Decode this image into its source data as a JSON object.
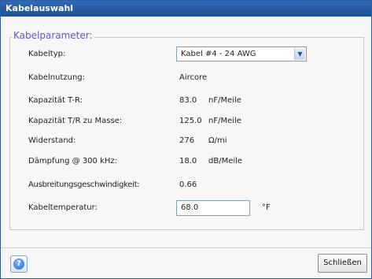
{
  "window": {
    "title": "Kabelauswahl"
  },
  "group": {
    "legend": "Kabelparameter:"
  },
  "fields": {
    "kabeltyp": {
      "label": "Kabeltyp:",
      "selected": "Kabel #4 - 24 AWG"
    },
    "kabelnutzung": {
      "label": "Kabelnutzung:",
      "value": "Aircore"
    },
    "kapazitaet_tr": {
      "label": "Kapazität T-R:",
      "value": "83.0",
      "unit": "nF/Meile"
    },
    "kapazitaet_masse": {
      "label": "Kapazität T/R zu Masse:",
      "value": "125.0",
      "unit": "nF/Meile"
    },
    "widerstand": {
      "label": "Widerstand:",
      "value": "276",
      "unit": "Ω/mi"
    },
    "daempfung": {
      "label": "Dämpfung @ 300 kHz:",
      "value": "18.0",
      "unit": "dB/Meile"
    },
    "ausbreitung": {
      "label": "Ausbreitungsgeschwindigkeit:",
      "value": "0.66"
    },
    "temperatur": {
      "label": "Kabeltemperatur:",
      "value": "68.0",
      "unit": "°F"
    }
  },
  "footer": {
    "help_icon": "question-mark",
    "help_glyph": "?",
    "close_label": "Schließen"
  },
  "colors": {
    "titlebar": "#2f6bb5",
    "legend": "#6a52c7"
  }
}
